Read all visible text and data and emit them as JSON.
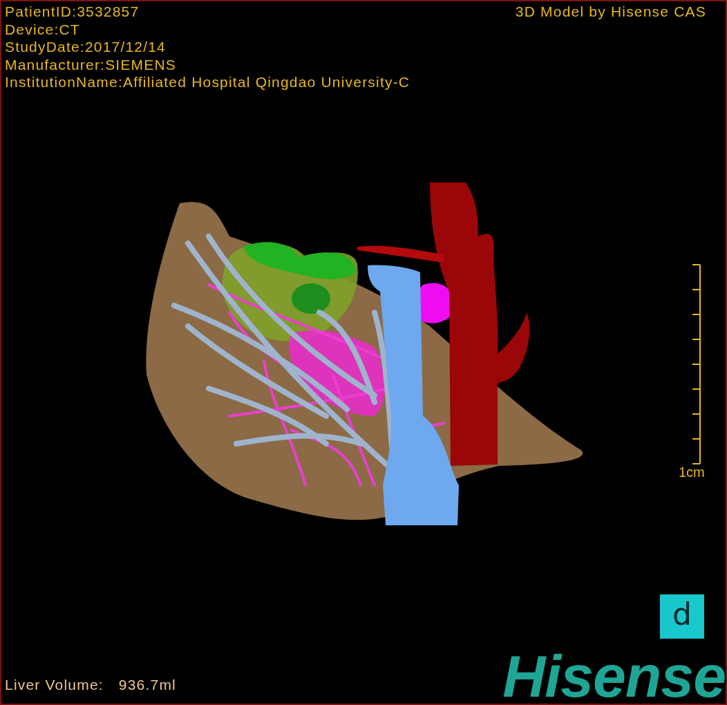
{
  "patient_info": [
    "PatientID:3532857",
    "Device:CT",
    "StudyDate:2017/12/14",
    "Manufacturer:SIEMENS",
    "InstitutionName:Affiliated Hospital Qingdao University-C"
  ],
  "title": "3D Model by Hisense CAS",
  "scale_bar": {
    "label": "1cm"
  },
  "view_button": {
    "label": "d"
  },
  "logo": {
    "text": "Hisense"
  },
  "liver_volume": {
    "label": "Liver Volume:",
    "value": "936.7ml"
  }
}
